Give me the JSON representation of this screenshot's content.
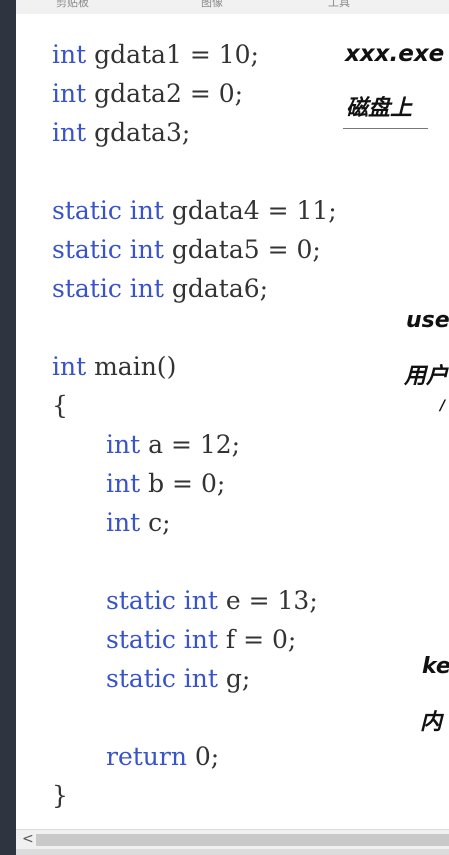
{
  "ribbon": {
    "items": [
      "剪贴板",
      "图像",
      "工具"
    ]
  },
  "code": {
    "keyword_int": "int",
    "keyword_static": "static",
    "keyword_return": "return",
    "lines": [
      " gdata1 = 10;",
      " gdata2 = 0;",
      " gdata3;",
      " gdata4 = 11;",
      " gdata5 = 0;",
      " gdata6;",
      " main()",
      "{",
      " a = 12;",
      " b = 0;",
      " c;",
      " e = 13;",
      " f = 0;",
      " g;",
      " 0;",
      "}"
    ]
  },
  "annotations": {
    "exe": "xxx.exe",
    "disk": "磁盘上",
    "user": "use",
    "user_cn": "用户",
    "kernel": "ke",
    "kernel_cn": "内"
  },
  "scrollbar": {
    "left_arrow": "<"
  },
  "colors": {
    "keyword": "#3953c8",
    "code_text": "#333333",
    "gutter": "#2f3540"
  }
}
